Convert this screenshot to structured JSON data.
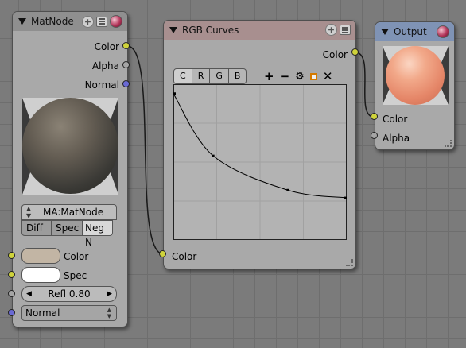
{
  "matnode": {
    "title": "MatNode",
    "outputs": [
      "Color",
      "Alpha",
      "Normal"
    ],
    "material": {
      "name": "MA:MatNode",
      "toggles": [
        "Diff",
        "Spec",
        "Neg N"
      ]
    },
    "inputs": {
      "color": "Color",
      "spec": "Spec",
      "refl": "Refl 0.80",
      "normal": "Normal"
    },
    "colors": {
      "color_swatch": "#c2b5a4",
      "spec_swatch": "#ffffff"
    }
  },
  "rgb_curves": {
    "title": "RGB Curves",
    "output": "Color",
    "input": "Color",
    "channels": [
      "C",
      "R",
      "G",
      "B"
    ],
    "active_channel": "C",
    "tools": [
      "zoom-in-icon",
      "zoom-out-icon",
      "wrench-icon",
      "clip-icon",
      "delete-icon"
    ],
    "curve_points": [
      [
        0.0,
        0.94
      ],
      [
        0.23,
        0.54
      ],
      [
        0.66,
        0.32
      ],
      [
        1.0,
        0.27
      ]
    ]
  },
  "output_node": {
    "title": "Output",
    "inputs": [
      "Color",
      "Alpha"
    ]
  }
}
